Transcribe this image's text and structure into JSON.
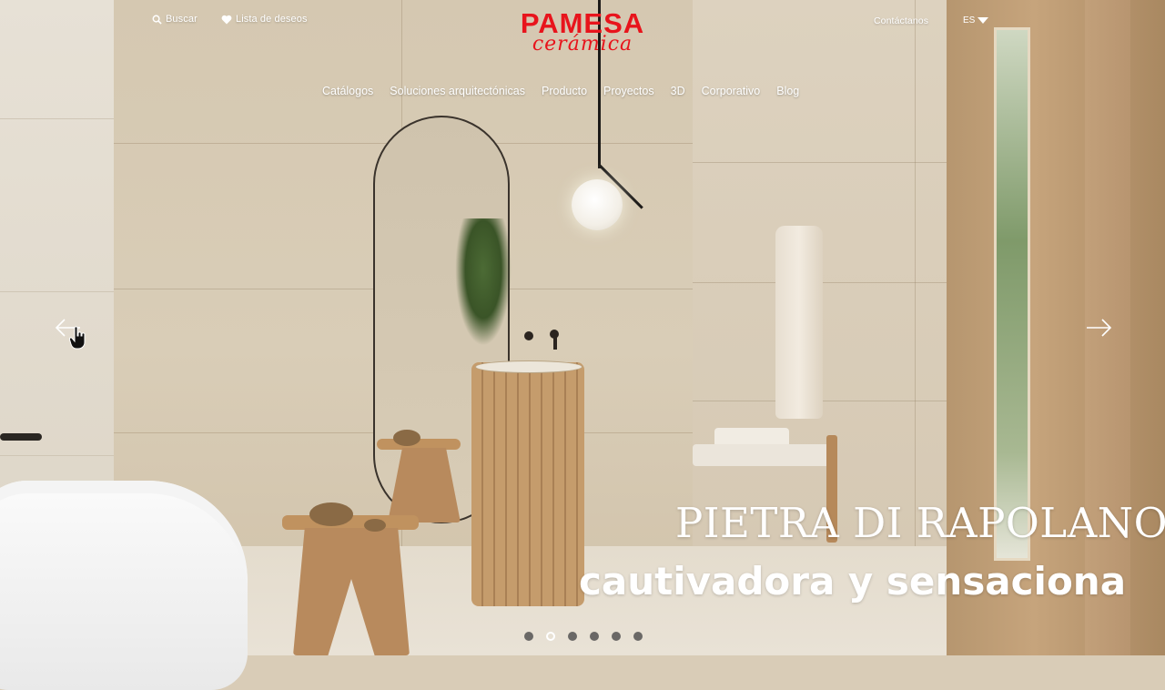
{
  "header": {
    "search_label": "Buscar",
    "wishlist_label": "Lista de deseos",
    "contact_label": "Contáctanos",
    "language": "ES",
    "logo": {
      "brand": "PAMESA",
      "sub": "cerámica",
      "color": "#e8141c"
    }
  },
  "nav": {
    "items": [
      {
        "label": "Catálogos"
      },
      {
        "label": "Soluciones arquitectónicas"
      },
      {
        "label": "Producto"
      },
      {
        "label": "Proyectos"
      },
      {
        "label": "3D"
      },
      {
        "label": "Corporativo"
      },
      {
        "label": "Blog"
      }
    ]
  },
  "hero": {
    "title": "PIETRA DI RAPOLANO",
    "subtitle": "cautivadora y sensaciona",
    "slide_count": 6,
    "active_slide": 2
  },
  "icons": {
    "search": "search-icon",
    "wishlist": "heart-icon",
    "language": "caret-down-icon",
    "prev": "arrow-left-icon",
    "next": "arrow-right-icon",
    "cursor": "pointer-cursor-icon"
  },
  "colors": {
    "brand": "#e8141c",
    "text": "#ffffff"
  }
}
